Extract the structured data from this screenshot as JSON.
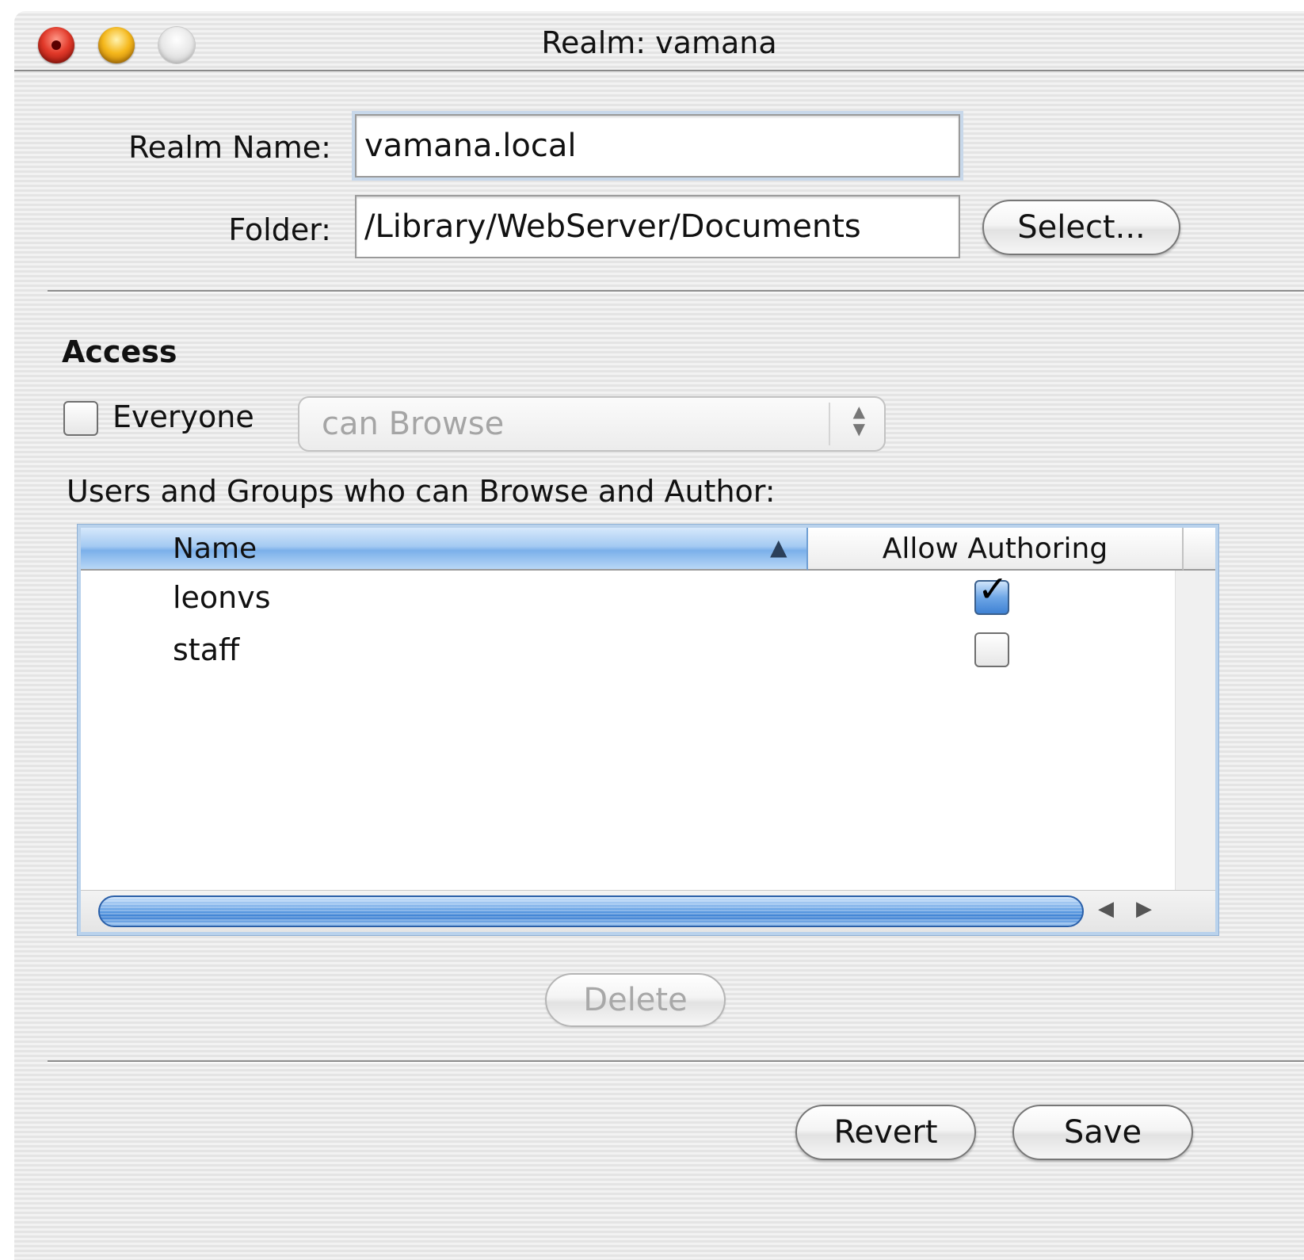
{
  "window": {
    "title": "Realm: vamana"
  },
  "form": {
    "realm_name_label": "Realm Name:",
    "realm_name_value": "vamana.local",
    "folder_label": "Folder:",
    "folder_value": "/Library/WebServer/Documents",
    "select_button": "Select..."
  },
  "access": {
    "heading": "Access",
    "everyone_label": "Everyone",
    "everyone_checked": false,
    "permission_popup": "can Browse",
    "users_caption": "Users and Groups who can Browse and Author:"
  },
  "table": {
    "columns": [
      "Name",
      "Allow Authoring"
    ],
    "sort_column": "Name",
    "sort_direction": "ascending",
    "rows": [
      {
        "name": "leonvs",
        "allow_authoring": true
      },
      {
        "name": "staff",
        "allow_authoring": false
      }
    ]
  },
  "buttons": {
    "delete": "Delete",
    "revert": "Revert",
    "save": "Save"
  },
  "icons": {
    "close": "close-icon",
    "minimize": "minimize-icon",
    "zoom": "zoom-icon",
    "sort": "sort-ascending-icon",
    "popup_arrows": "up-down-arrows-icon",
    "scroll_left": "scroll-left-icon",
    "scroll_right": "scroll-right-icon",
    "checkmark": "checkmark-icon"
  },
  "colors": {
    "accent": "#6aa6e6",
    "close": "#e23a2a",
    "minimize": "#f5b81c"
  }
}
